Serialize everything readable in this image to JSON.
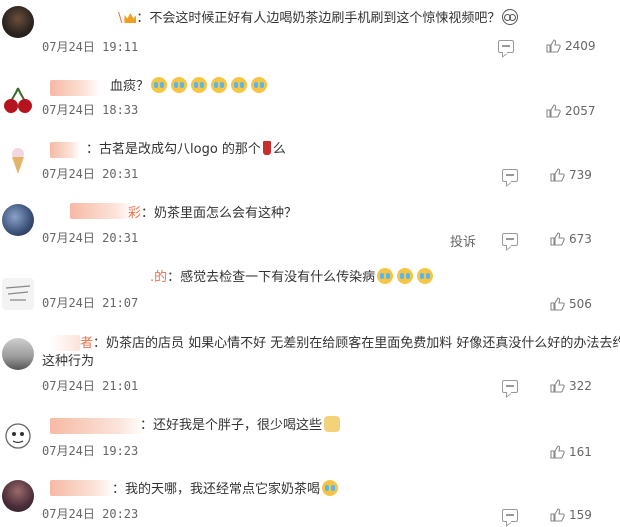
{
  "comments": [
    {
      "name_suffix": "\\",
      "text": "：不会这时候正好有人边喝奶茶边刷手机刷到这个惊悚视频吧？",
      "time": "07月24日 19:11",
      "likes": "2409",
      "report": ""
    },
    {
      "name_suffix": "",
      "text": "血痰？",
      "time": "07月24日 18:33",
      "likes": "2057",
      "report": ""
    },
    {
      "name_suffix": "",
      "text": "：古茗是改成勾八logo 的那个",
      "text2": "么",
      "time": "07月24日 20:31",
      "likes": "739",
      "report": ""
    },
    {
      "name_suffix": "彩",
      "text": "：奶茶里面怎么会有这种？",
      "time": "07月24日 20:31",
      "likes": "673",
      "report": "投诉"
    },
    {
      "name_suffix": ".的",
      "text": "：感觉去检查一下有没有什么传染病",
      "time": "07月24日 21:07",
      "likes": "506",
      "report": ""
    },
    {
      "name_suffix": "者",
      "text": "：奶茶店的店员 如果心情不好 无差别在给顾客在里面免费加料 好像还真没什么好的办法去约束",
      "text_line2": "这种行为",
      "time": "07月24日 21:01",
      "likes": "322",
      "report": ""
    },
    {
      "name_suffix": "",
      "text": "：还好我是个胖子，很少喝这些",
      "time": "07月24日 19:23",
      "likes": "161",
      "report": ""
    },
    {
      "name_suffix": "",
      "text": "：我的天哪，我还经常点它家奶茶喝",
      "time": "07月24日 20:23",
      "likes": "159",
      "report": ""
    }
  ]
}
